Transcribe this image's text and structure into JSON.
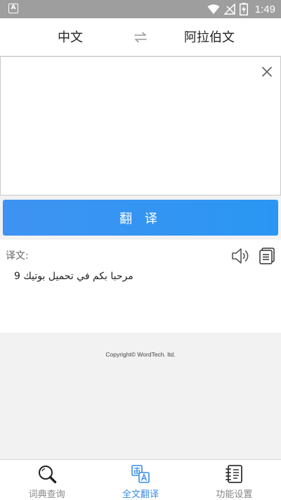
{
  "status_bar": {
    "app_badge": "A",
    "time": "1:49",
    "icons": [
      "wifi-icon",
      "signal-off-icon",
      "battery-charging-icon"
    ]
  },
  "language_bar": {
    "source_language": "中文",
    "target_language": "阿拉伯文",
    "swap_icon": "swap-arrows-icon"
  },
  "input": {
    "value": "",
    "placeholder": "",
    "clear_icon": "close-icon"
  },
  "translate_button": {
    "label": "翻 译"
  },
  "result": {
    "label": "译文:",
    "text": "مرحبا بكم في تحميل بوتيك 9",
    "speaker_icon": "speaker-icon",
    "copy_icon": "copy-icon"
  },
  "footer": {
    "copyright": "Copyright© WordTech. ltd."
  },
  "bottom_nav": {
    "items": [
      {
        "label": "词典查询",
        "icon": "search-icon",
        "active": false
      },
      {
        "label": "全文翻译",
        "icon": "translate-icon",
        "active": true
      },
      {
        "label": "功能设置",
        "icon": "notebook-icon",
        "active": false
      }
    ]
  },
  "colors": {
    "accent": "#3a8be8",
    "button_gradient_start": "#3f93f2",
    "button_gradient_end": "#2a96f3",
    "status_bar": "#9e9e9e",
    "background": "#f2f2f2"
  }
}
